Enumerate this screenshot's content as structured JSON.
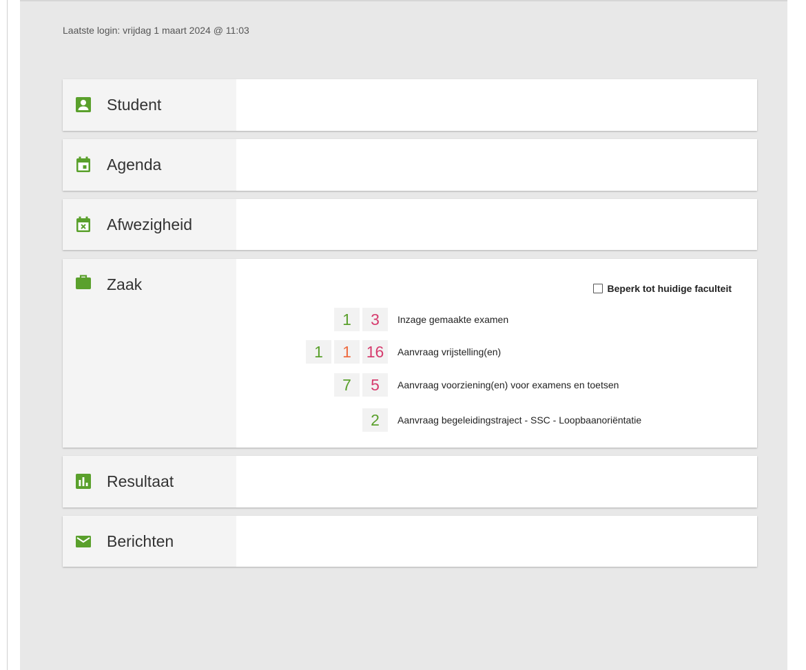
{
  "last_login": "Laatste login: vrijdag 1 maart 2024 @ 11:03",
  "accent_color": "#5aa02c",
  "panels": {
    "student": {
      "title": "Student",
      "icon": "account-box-icon"
    },
    "agenda": {
      "title": "Agenda",
      "icon": "calendar-icon"
    },
    "afwezigheid": {
      "title": "Afwezigheid",
      "icon": "calendar-remove-icon"
    },
    "zaak": {
      "title": "Zaak",
      "icon": "briefcase-icon"
    },
    "resultaat": {
      "title": "Resultaat",
      "icon": "bar-chart-icon"
    },
    "berichten": {
      "title": "Berichten",
      "icon": "envelope-icon"
    }
  },
  "zaak": {
    "filter_label": "Beperk tot huidige faculteit",
    "filter_checked": false,
    "rows": [
      {
        "label": "Inzage gemaakte examen",
        "counts": [
          {
            "value": "1",
            "color": "#5aa02c"
          },
          {
            "value": "3",
            "color": "#d63c6e"
          }
        ]
      },
      {
        "label": "Aanvraag vrijstelling(en)",
        "counts": [
          {
            "value": "1",
            "color": "#5aa02c"
          },
          {
            "value": "1",
            "color": "#ee6b40"
          },
          {
            "value": "16",
            "color": "#d63c6e"
          }
        ]
      },
      {
        "label": "Aanvraag voorziening(en) voor examens en toetsen",
        "counts": [
          {
            "value": "7",
            "color": "#5aa02c"
          },
          {
            "value": "5",
            "color": "#d63c6e"
          }
        ]
      },
      {
        "label": "Aanvraag begeleidingstraject - SSC - Loopbaanoriëntatie",
        "counts": [
          {
            "value": "2",
            "color": "#5aa02c"
          }
        ]
      }
    ]
  }
}
